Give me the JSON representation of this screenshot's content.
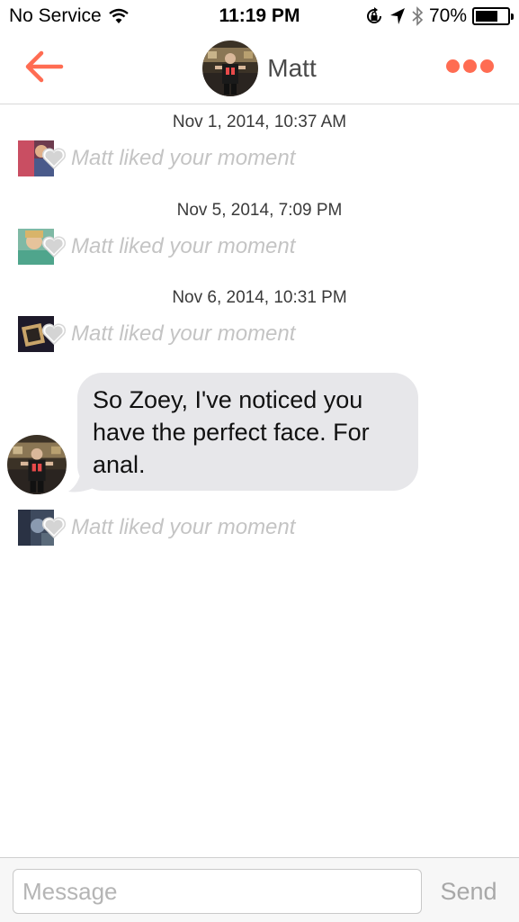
{
  "status_bar": {
    "carrier": "No Service",
    "time": "11:19 PM",
    "battery": "70%",
    "battery_level": 0.7
  },
  "header": {
    "title": "Matt",
    "accent_color": "#ff6c52"
  },
  "feed": {
    "timestamps": [
      "Nov 1, 2014, 10:37 AM",
      "Nov 5, 2014, 7:09 PM",
      "Nov 6, 2014, 10:31 PM"
    ],
    "moments": [
      {
        "text": "Matt liked your moment"
      },
      {
        "text": "Matt liked your moment"
      },
      {
        "text": "Matt liked your moment"
      },
      {
        "text": "Matt liked your moment"
      }
    ],
    "message": {
      "lines": [
        "So Zoey, I've noticed you",
        "have the perfect face.  For",
        "anal."
      ]
    }
  },
  "input_bar": {
    "placeholder": "Message",
    "send_label": "Send"
  }
}
